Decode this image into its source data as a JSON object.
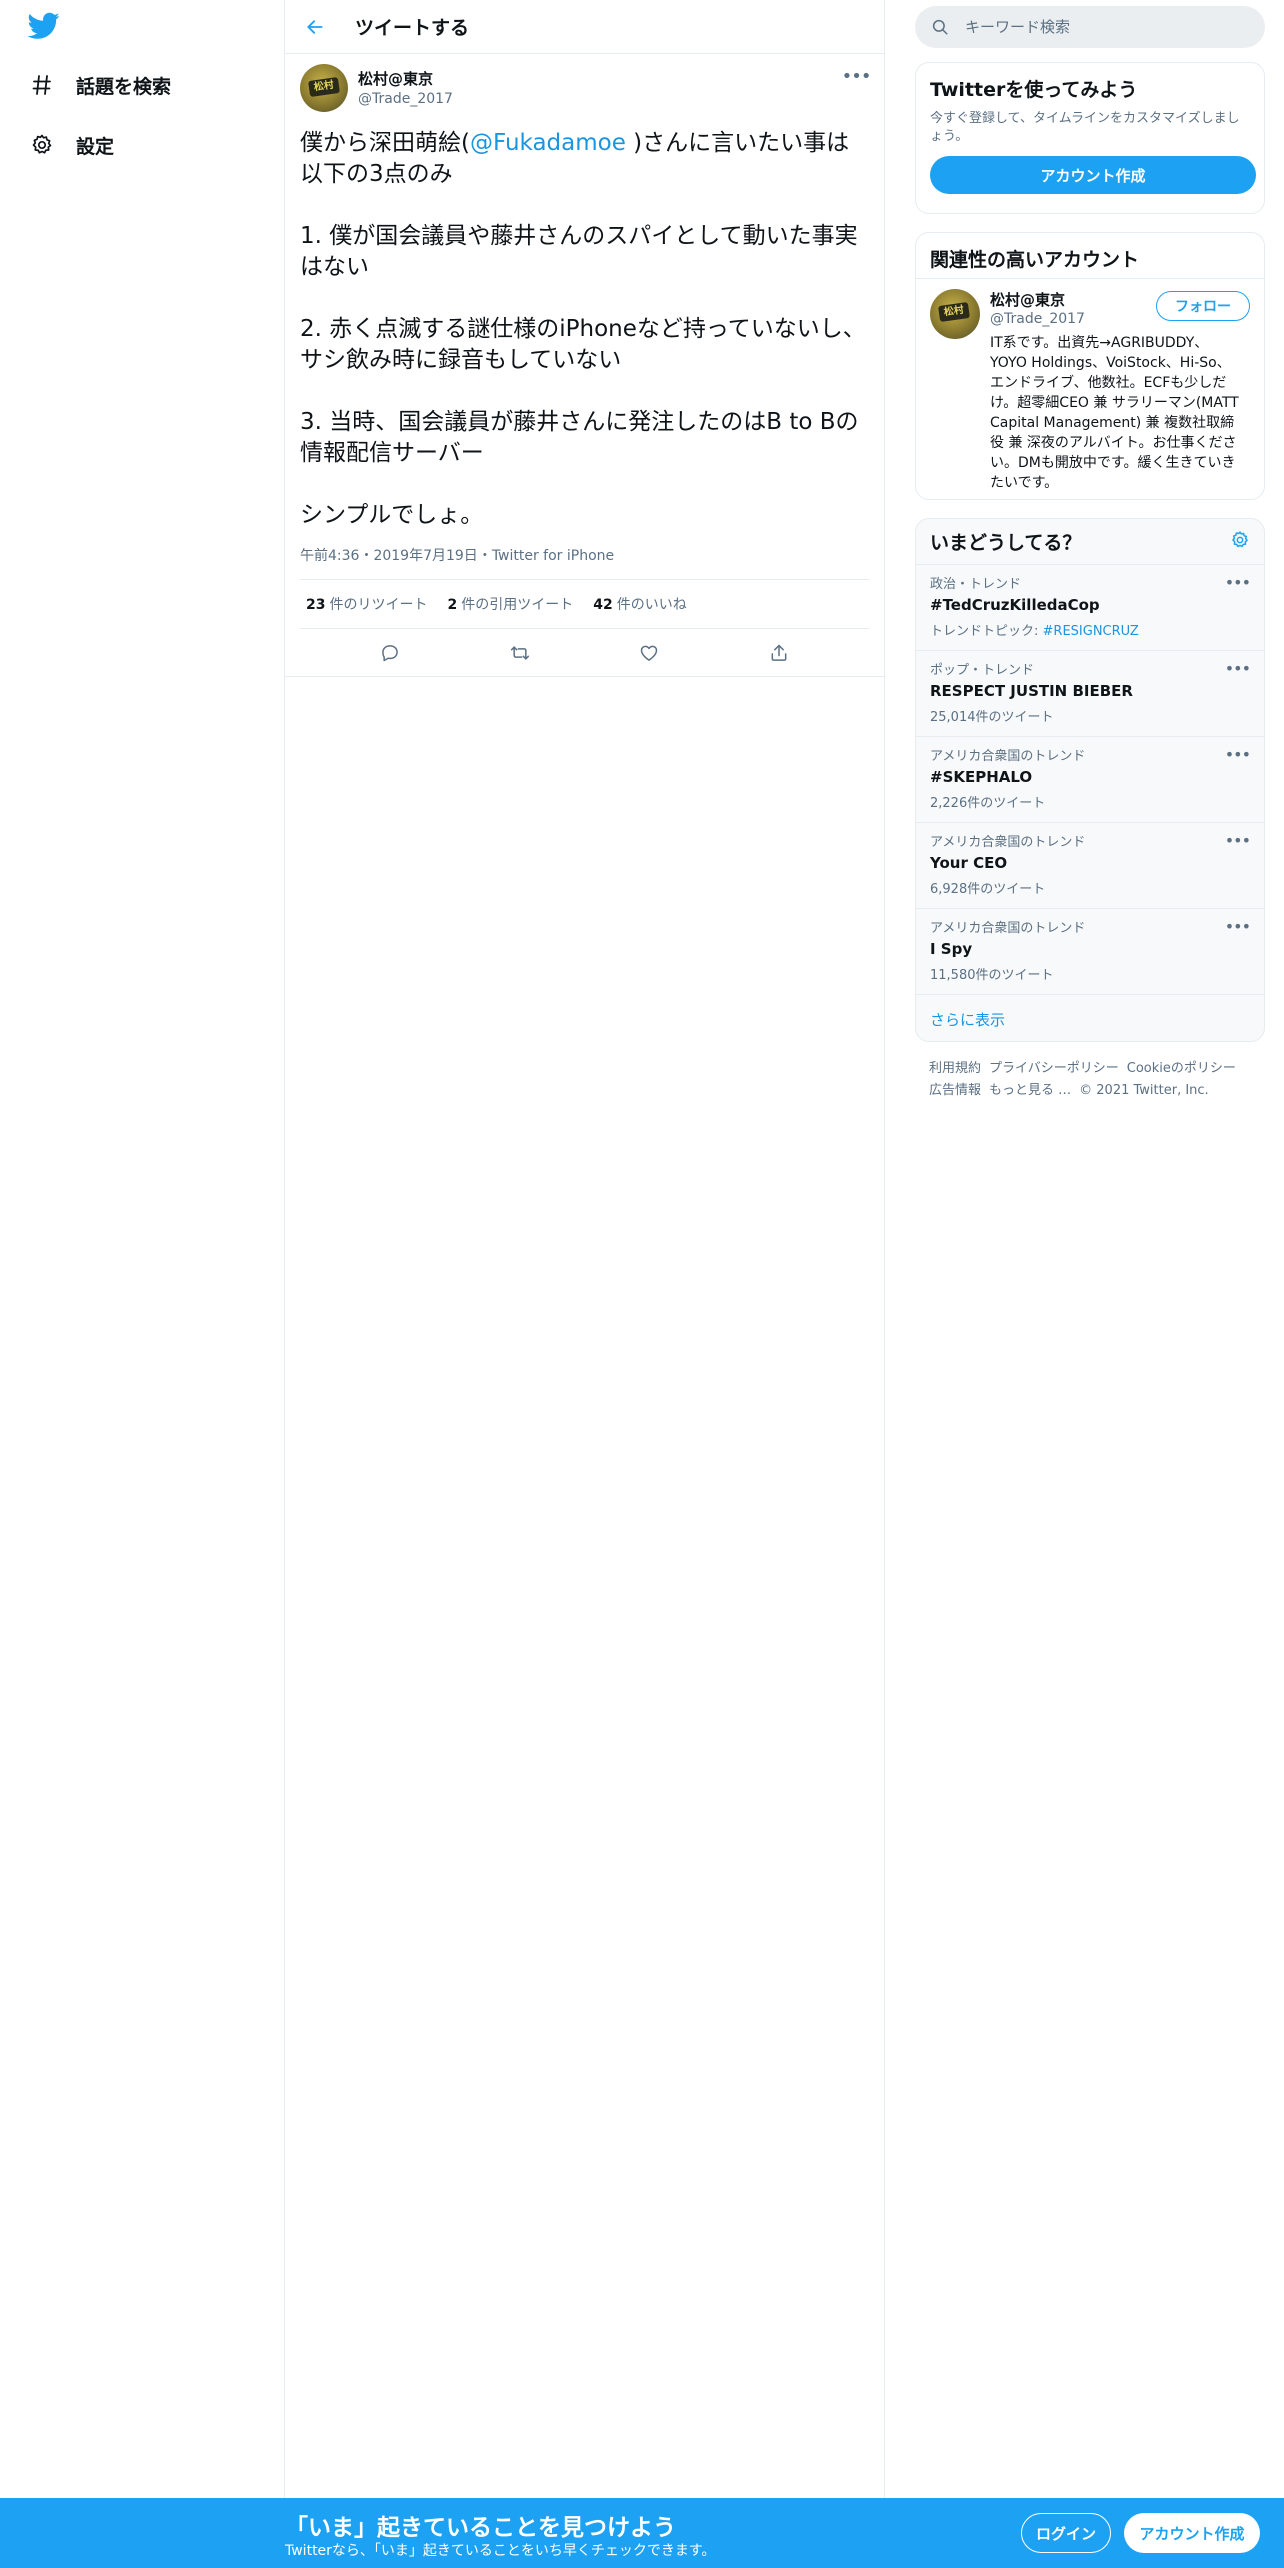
{
  "colors": {
    "accent": "#1da1f2",
    "link": "#1b95e0",
    "text": "#0f1419",
    "muted": "#5b7083",
    "border": "#e6ecf0"
  },
  "nav": {
    "logo_icon": "twitter-bird-icon",
    "items": [
      {
        "icon": "hashtag-icon",
        "label": "話題を検索"
      },
      {
        "icon": "gear-icon",
        "label": "設定"
      }
    ]
  },
  "header": {
    "title": "ツイートする",
    "back_icon": "arrow-left-icon"
  },
  "tweet": {
    "author": {
      "display_name": "松村@東京",
      "handle": "@Trade_2017",
      "avatar_text": "松村"
    },
    "body_prefix": "僕から深田萌絵(",
    "mention": "@Fukadamoe",
    "body_suffix": " )さんに言いたい事は以下の3点のみ\n\n1. 僕が国会議員や藤井さんのスパイとして動いた事実はない\n\n2. 赤く点滅する謎仕様のiPhoneなど持っていないし、サシ飲み時に録音もしていない\n\n3. 当時、国会議員が藤井さんに発注したのはB to Bの情報配信サーバー\n\nシンプルでしょ。",
    "time": "午前4:36",
    "date": "2019年7月19日",
    "source": "Twitter for iPhone",
    "sep": "・",
    "stats": {
      "retweets": {
        "count": "23",
        "label": "件のリツイート"
      },
      "quotes": {
        "count": "2",
        "label": "件の引用ツイート"
      },
      "likes": {
        "count": "42",
        "label": "件のいいね"
      }
    }
  },
  "search": {
    "placeholder": "キーワード検索"
  },
  "signup_card": {
    "title": "Twitterを使ってみよう",
    "desc": "今すぐ登録して、タイムラインをカスタマイズしましょう。",
    "button": "アカウント作成"
  },
  "related": {
    "title": "関連性の高いアカウント",
    "user": {
      "display_name": "松村@東京",
      "handle": "@Trade_2017",
      "follow": "フォロー",
      "bio": "IT系です。出資先→AGRIBUDDY、YOYO Holdings、VoiStock、Hi-So、エンドライブ、他数社。ECFも少しだけ。超零細CEO 兼 サラリーマン(MATT Capital Management) 兼 複数社取締役 兼 深夜のアルバイト。お仕事ください。DMも開放中です。緩く生きていきたいです。"
    }
  },
  "trends": {
    "title": "いまどうしてる？",
    "items": [
      {
        "context": "政治・トレンド",
        "name": "#TedCruzKilledaCop",
        "sub_prefix": "トレンドトピック: ",
        "sub_link": "#RESIGNCRUZ"
      },
      {
        "context": "ポップ・トレンド",
        "name": "RESPECT JUSTIN BIEBER",
        "sub_prefix": "25,014件のツイート",
        "sub_link": ""
      },
      {
        "context": "アメリカ合衆国のトレンド",
        "name": "#SKEPHALO",
        "sub_prefix": "2,226件のツイート",
        "sub_link": ""
      },
      {
        "context": "アメリカ合衆国のトレンド",
        "name": "Your CEO",
        "sub_prefix": "6,928件のツイート",
        "sub_link": ""
      },
      {
        "context": "アメリカ合衆国のトレンド",
        "name": "I Spy",
        "sub_prefix": "11,580件のツイート",
        "sub_link": ""
      }
    ],
    "show_more": "さらに表示"
  },
  "footer": {
    "links": [
      "利用規約",
      "プライバシーポリシー",
      "Cookieのポリシー",
      "広告情報",
      "もっと見る …"
    ],
    "copyright": "© 2021 Twitter, Inc."
  },
  "bottom_bar": {
    "title": "「いま」起きていることを見つけよう",
    "subtitle": "Twitterなら、「いま」起きていることをいち早くチェックできます。",
    "login": "ログイン",
    "signup": "アカウント作成"
  }
}
